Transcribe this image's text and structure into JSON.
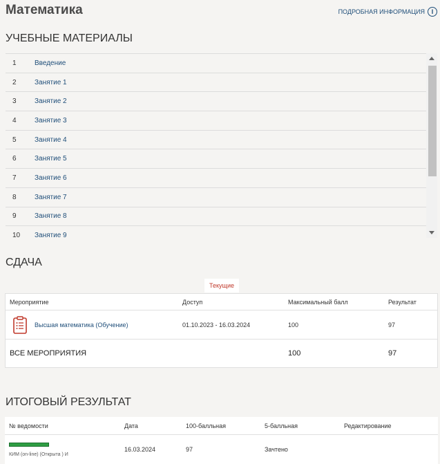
{
  "header": {
    "title": "Математика",
    "info_link": "ПОДРОБНАЯ ИНФОРМАЦИЯ"
  },
  "materials": {
    "heading": "УЧЕБНЫЕ МАТЕРИАЛЫ",
    "items": [
      {
        "num": "1",
        "label": "Введение"
      },
      {
        "num": "2",
        "label": "Занятие 1"
      },
      {
        "num": "3",
        "label": "Занятие 2"
      },
      {
        "num": "4",
        "label": "Занятие 3"
      },
      {
        "num": "5",
        "label": "Занятие 4"
      },
      {
        "num": "6",
        "label": "Занятие 5"
      },
      {
        "num": "7",
        "label": "Занятие 6"
      },
      {
        "num": "8",
        "label": "Занятие 7"
      },
      {
        "num": "9",
        "label": "Занятие 8"
      },
      {
        "num": "10",
        "label": "Занятие 9"
      }
    ]
  },
  "submission": {
    "heading": "СДАЧА",
    "tab_current": "Текущие",
    "columns": [
      "Мероприятие",
      "Доступ",
      "Максимальный балл",
      "Результат"
    ],
    "row": {
      "event": "Высшая математика (Обучение)",
      "access": "01.10.2023 - 16.03.2024",
      "max": "100",
      "result": "97"
    },
    "total": {
      "label": "ВСЕ МЕРОПРИЯТИЯ",
      "max": "100",
      "result": "97"
    }
  },
  "final": {
    "heading": "ИТОГОВЫЙ РЕЗУЛЬТАТ",
    "columns": [
      "№ ведомости",
      "Дата",
      "100-балльная",
      "5-балльная",
      "Редактирование"
    ],
    "row": {
      "sheet": "КИМ (on-line) (Открыта ) И",
      "date": "16.03.2024",
      "score100": "97",
      "score5": "Зачтено",
      "edit": ""
    }
  },
  "colors": {
    "link": "#1f4e79",
    "tab_active": "#c0392b",
    "icon_red": "#c0392b",
    "progress_green": "#2f9e44"
  }
}
